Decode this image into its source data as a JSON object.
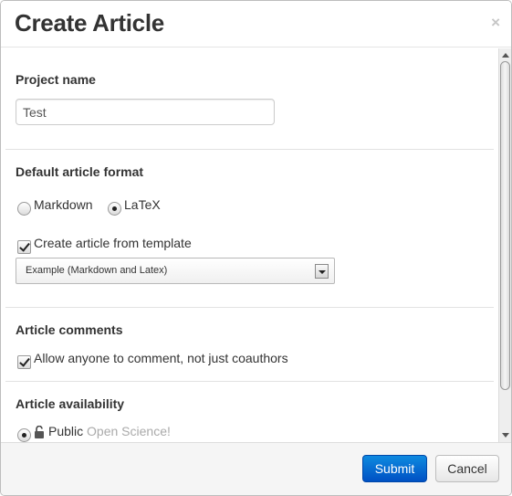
{
  "dialog": {
    "title": "Create Article",
    "close_glyph": "×"
  },
  "project": {
    "heading": "Project name",
    "name_value": "Test"
  },
  "format": {
    "heading": "Default article format",
    "options": [
      {
        "label": "Markdown",
        "selected": false
      },
      {
        "label": "LaTeX",
        "selected": true
      }
    ],
    "template_checkbox_label": "Create article from template",
    "template_checked": true,
    "template_select_value": "Example (Markdown and Latex)"
  },
  "comments": {
    "heading": "Article comments",
    "allow_label": "Allow anyone to comment, not just coauthors",
    "allow_checked": true
  },
  "availability": {
    "heading": "Article availability",
    "public_label": "Public",
    "public_note": "Open Science!",
    "public_selected": true,
    "lock_icon": "unlocked-padlock-icon"
  },
  "footer": {
    "submit_label": "Submit",
    "cancel_label": "Cancel"
  },
  "colors": {
    "primary_button": "#0a6fd8",
    "muted_text": "#aaaaaa"
  }
}
